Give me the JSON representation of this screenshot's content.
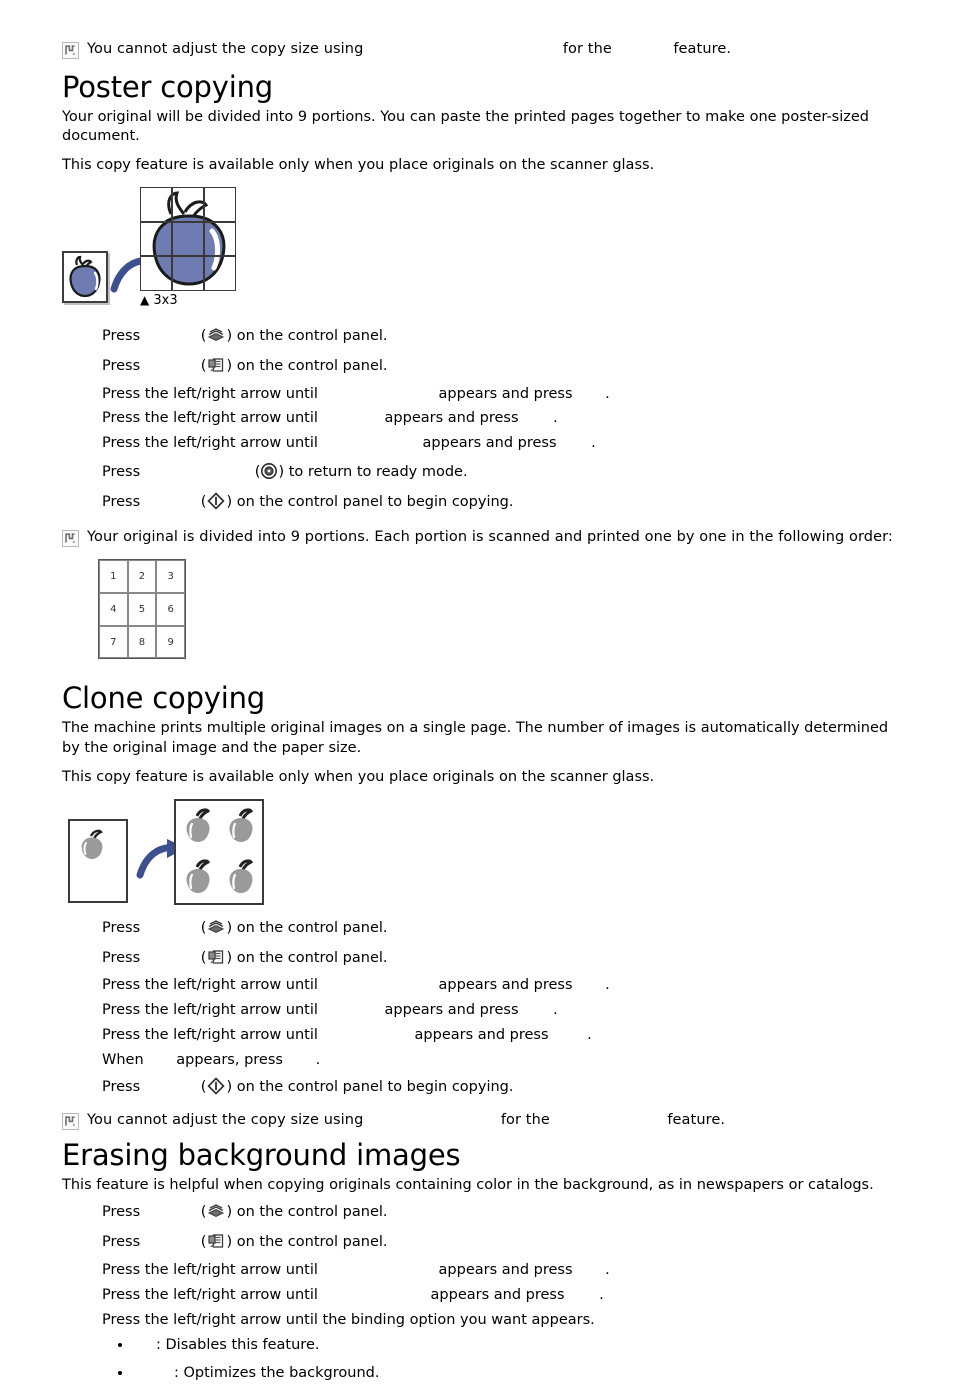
{
  "page": {
    "notes": [
      {
        "id": "note-top",
        "text_before": "You cannot adjust the copy size using",
        "gap1_width": 190,
        "text_middle": "for the",
        "gap2_width": 52,
        "text_after": "feature."
      },
      {
        "id": "note-poster-order",
        "text": "Your original is divided into 9 portions. Each portion is scanned and printed one by one in the following order:"
      },
      {
        "id": "note-clone",
        "text_before": "You cannot adjust the copy size using",
        "gap1_width": 128,
        "text_middle": "for the",
        "gap2_width": 108,
        "text_after": "feature."
      }
    ],
    "sections": [
      {
        "id": "poster-copying",
        "title": "Poster copying",
        "paragraphs": [
          "Your original will be divided into 9 portions. You can paste the printed pages together to make one poster-sized document.",
          "This copy feature is available only when you place originals on the scanner glass."
        ],
        "figure": {
          "caption": "3x3",
          "caption_marker": "▲",
          "apple_color": "#6f7cb2",
          "apple_stroke": "#1a1a1a"
        },
        "steps": [
          {
            "type": "press-icon",
            "lead": "Press",
            "gap": 56,
            "icon": "copy-stack-icon",
            "tail": ") on the control panel.",
            "open": "("
          },
          {
            "type": "press-icon",
            "lead": "Press",
            "gap": 56,
            "icon": "menu-document-icon",
            "tail": ") on the control panel.",
            "open": "("
          },
          {
            "type": "arrow-step",
            "lead": "Press the left/right arrow until",
            "gap1": 116,
            "mid": "appears and press",
            "gap2": 28,
            "tail": "."
          },
          {
            "type": "arrow-step",
            "lead": "Press the left/right arrow until",
            "gap1": 62,
            "mid": "appears and press",
            "gap2": 30,
            "tail": "."
          },
          {
            "type": "arrow-step",
            "lead": "Press the left/right arrow until",
            "gap1": 100,
            "mid": "appears and press",
            "gap2": 30,
            "tail": "."
          },
          {
            "type": "press-icon",
            "lead": "Press",
            "gap": 110,
            "icon": "stop-clear-icon",
            "tail": ") to return to ready mode.",
            "open": "("
          },
          {
            "type": "press-icon",
            "lead": "Press",
            "gap": 56,
            "icon": "start-diamond-icon",
            "tail": ") on the control panel to begin copying.",
            "open": "("
          }
        ],
        "order_grid": {
          "rows": [
            [
              "1",
              "2",
              "3"
            ],
            [
              "4",
              "5",
              "6"
            ],
            [
              "7",
              "8",
              "9"
            ]
          ]
        }
      },
      {
        "id": "clone-copying",
        "title": "Clone copying",
        "paragraphs": [
          "The machine prints multiple original images on a single page. The number of images is automatically determined by the original image and the paper size.",
          "This copy feature is available only when you place originals on the scanner glass."
        ],
        "figure": {
          "apple_color": "#9a9a9a",
          "apple_stroke": "#222222",
          "copies": 4
        },
        "steps": [
          {
            "type": "press-icon",
            "lead": "Press",
            "gap": 56,
            "icon": "copy-stack-icon",
            "tail": ") on the control panel.",
            "open": "("
          },
          {
            "type": "press-icon",
            "lead": "Press",
            "gap": 56,
            "icon": "menu-document-icon",
            "tail": ") on the control panel.",
            "open": "("
          },
          {
            "type": "arrow-step",
            "lead": "Press the left/right arrow until",
            "gap1": 116,
            "mid": "appears and press",
            "gap2": 28,
            "tail": "."
          },
          {
            "type": "arrow-step",
            "lead": "Press the left/right arrow until",
            "gap1": 62,
            "mid": "appears and press",
            "gap2": 30,
            "tail": "."
          },
          {
            "type": "arrow-step",
            "lead": "Press the left/right arrow until",
            "gap1": 92,
            "mid": "appears and press",
            "gap2": 34,
            "tail": "."
          },
          {
            "type": "when-step",
            "lead": "When",
            "gap1": 28,
            "mid": "appears, press",
            "gap2": 28,
            "tail": "."
          },
          {
            "type": "press-icon",
            "lead": "Press",
            "gap": 56,
            "icon": "start-diamond-icon",
            "tail": ") on the control panel to begin copying.",
            "open": "("
          }
        ]
      },
      {
        "id": "erasing-background-images",
        "title": "Erasing background images",
        "paragraphs": [
          "This feature is helpful when copying originals containing color in the background, as in newspapers or catalogs."
        ],
        "steps": [
          {
            "type": "press-icon",
            "lead": "Press",
            "gap": 56,
            "icon": "copy-stack-icon",
            "tail": ") on the control panel.",
            "open": "("
          },
          {
            "type": "press-icon",
            "lead": "Press",
            "gap": 56,
            "icon": "menu-document-icon",
            "tail": ") on the control panel.",
            "open": "("
          },
          {
            "type": "arrow-step",
            "lead": "Press the left/right arrow until",
            "gap1": 116,
            "mid": "appears and press",
            "gap2": 28,
            "tail": "."
          },
          {
            "type": "arrow-step",
            "lead": "Press the left/right arrow until",
            "gap1": 108,
            "mid": "appears and press",
            "gap2": 30,
            "tail": "."
          },
          {
            "type": "plain-step",
            "text": "Press the left/right arrow until the binding option you want appears."
          }
        ],
        "bullets": [
          {
            "gap": 20,
            "text": ": Disables this feature."
          },
          {
            "gap": 38,
            "text": ": Optimizes the background."
          }
        ]
      }
    ]
  }
}
